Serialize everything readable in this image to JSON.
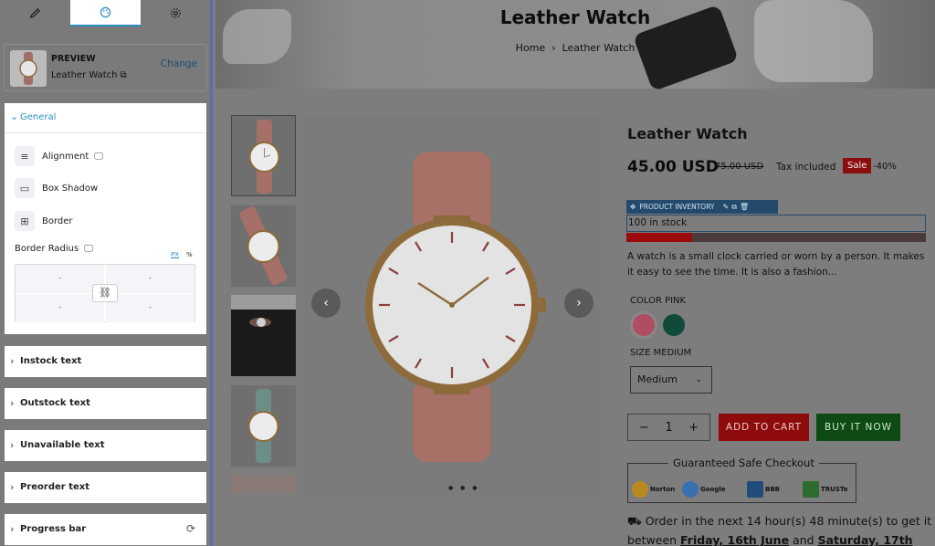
{
  "editor": {
    "tabs": [
      {
        "name": "edit",
        "icon": "pencil-icon"
      },
      {
        "name": "style",
        "icon": "palette-icon"
      },
      {
        "name": "settings",
        "icon": "gear-icon"
      }
    ],
    "preview": {
      "title": "PREVIEW",
      "product_name": "Leather Watch",
      "change_label": "Change"
    },
    "general": {
      "label": "General",
      "alignment_label": "Alignment",
      "box_shadow_label": "Box Shadow",
      "border_label": "Border",
      "border_radius_label": "Border Radius",
      "unit_px": "PX",
      "unit_percent": "%",
      "radius_values": [
        "-",
        "-",
        "-",
        "-"
      ]
    },
    "sections": [
      "Instock text",
      "Outstock text",
      "Unavailable text",
      "Preorder text",
      "Progress bar"
    ]
  },
  "page": {
    "hero_title": "Leather Watch",
    "breadcrumb_home": "Home",
    "breadcrumb_current": "Leather Watch",
    "product": {
      "title": "Leather Watch",
      "price": "45.00 USD",
      "compare_price": "75.00 USD",
      "tax_text": "Tax included",
      "sale_badge": "Sale",
      "discount": "-40%",
      "inventory_block_label": "PRODUCT INVENTORY",
      "stock_text": "100 in stock",
      "stock_fraction": 0.22,
      "description": "A watch is a small clock carried or worn by a person. It makes it easy to see the time. It is also a fashion...",
      "color_label": "COLOR PINK",
      "colors": [
        "#b04d63",
        "#0f4a3a"
      ],
      "size_label": "SIZE MEDIUM",
      "size_value": "Medium",
      "quantity": "1",
      "add_to_cart": "ADD TO CART",
      "buy_now": "BUY IT NOW",
      "guarantee_title": "Guaranteed Safe Checkout",
      "badges": [
        "Norton",
        "Google",
        "BBB",
        "TRUSTe"
      ],
      "delivery_prefix": "Order in the next 14 hour(s) 48 minute(s) to get it between",
      "delivery_date1": "Friday, 16th June",
      "delivery_and": "and",
      "delivery_date2": "Saturday, 17th"
    }
  }
}
